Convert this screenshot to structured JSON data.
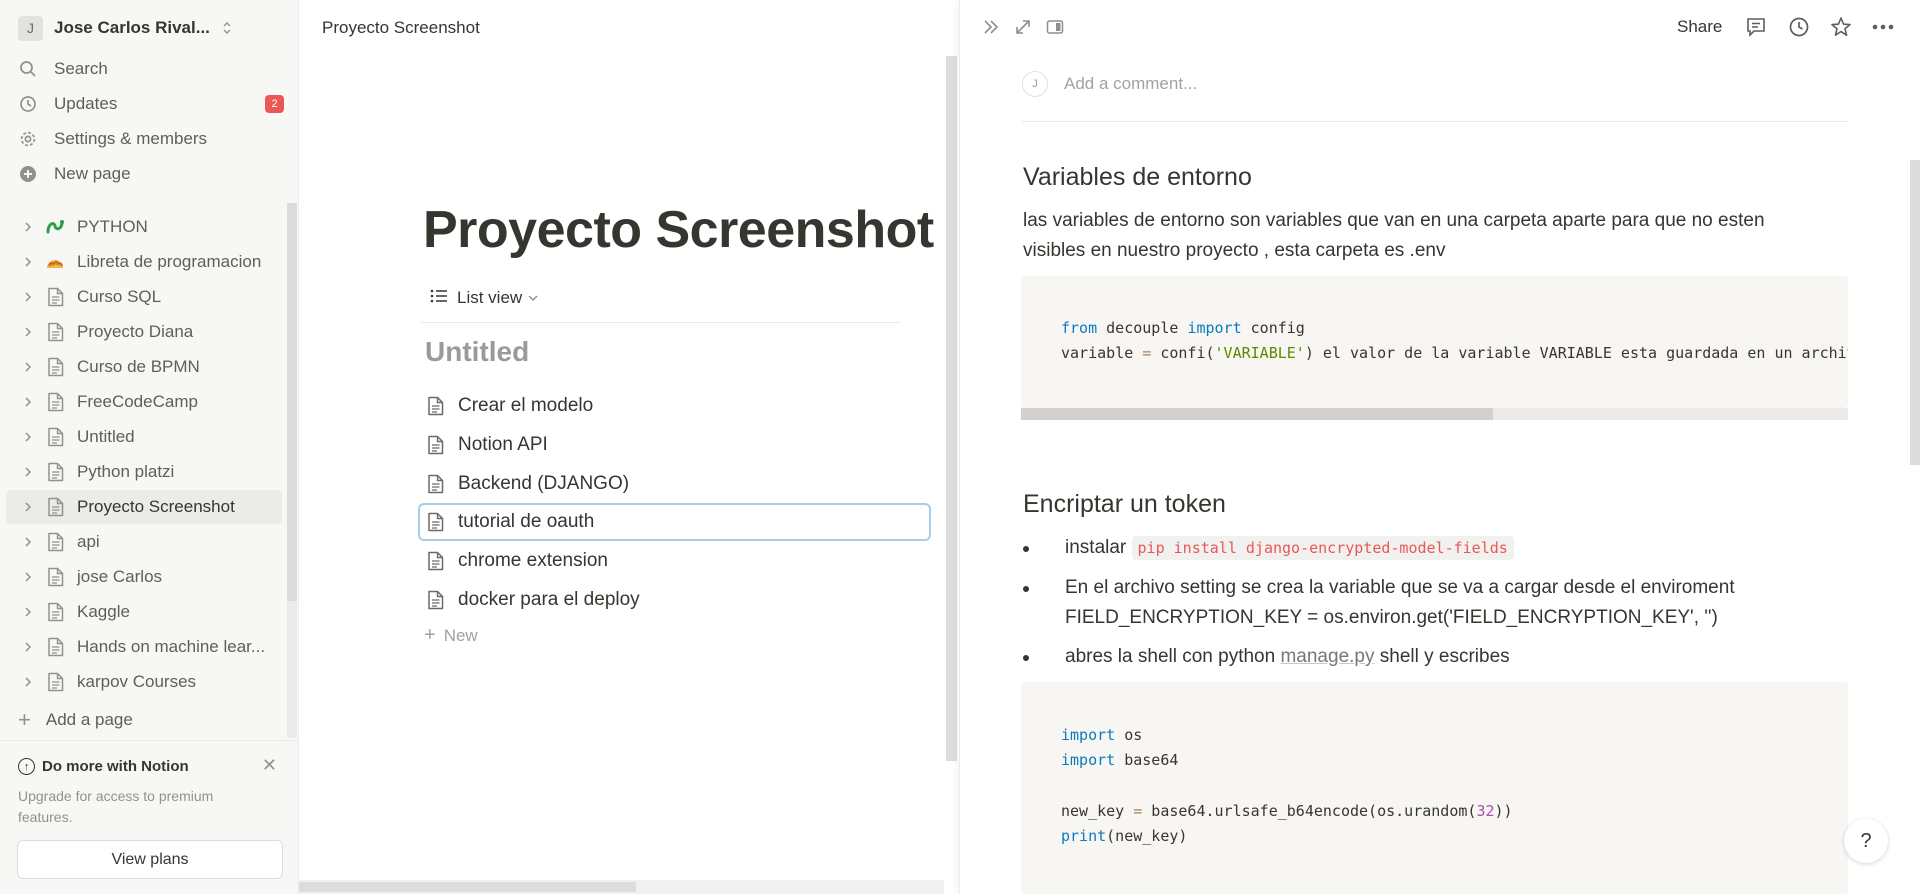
{
  "workspace": {
    "initial": "J",
    "name": "Jose Carlos Rival..."
  },
  "nav": {
    "search": "Search",
    "updates": "Updates",
    "updates_count": "2",
    "settings": "Settings & members",
    "new_page": "New page"
  },
  "pages": [
    {
      "label": "PYTHON",
      "icon": "python-icon"
    },
    {
      "label": "Libreta de programacion",
      "icon": "taco-emoji-icon"
    },
    {
      "label": "Curso SQL",
      "icon": "page-icon"
    },
    {
      "label": "Proyecto Diana",
      "icon": "page-icon"
    },
    {
      "label": "Curso de BPMN",
      "icon": "page-icon"
    },
    {
      "label": "FreeCodeCamp",
      "icon": "page-icon"
    },
    {
      "label": "Untitled",
      "icon": "page-icon"
    },
    {
      "label": "Python platzi",
      "icon": "page-icon"
    },
    {
      "label": "Proyecto Screenshot",
      "icon": "page-icon",
      "active": true
    },
    {
      "label": "api",
      "icon": "page-icon"
    },
    {
      "label": "jose Carlos",
      "icon": "page-icon"
    },
    {
      "label": "Kaggle",
      "icon": "page-icon"
    },
    {
      "label": "Hands on machine lear...",
      "icon": "page-icon"
    },
    {
      "label": "karpov Courses",
      "icon": "page-icon"
    }
  ],
  "add_page": "Add a page",
  "promo": {
    "title": "Do more with Notion",
    "text": "Upgrade for access to premium features.",
    "button": "View plans"
  },
  "middle": {
    "breadcrumb": "Proyecto Screenshot",
    "title": "Proyecto Screenshot",
    "view_label": "List view",
    "group_title": "Untitled",
    "items": [
      "Crear el modelo",
      "Notion API",
      "Backend (DJANGO)",
      "tutorial de oauth",
      "chrome extension",
      "docker para el deploy"
    ],
    "new_label": "New"
  },
  "right": {
    "share": "Share",
    "comment_avatar": "J",
    "comment_placeholder": "Add a comment...",
    "section1": {
      "heading": "Variables de entorno",
      "text": "las variables de entorno son variables que van en una carpeta aparte para que no esten visibles en nuestro proyecto , esta carpeta es .env",
      "code_kw1": "from",
      "code_mod": " decouple ",
      "code_kw2": "import",
      "code_rest1": " config",
      "code_l2a": "variable ",
      "code_l2op": "=",
      "code_l2b": " confi(",
      "code_l2str": "'VARIABLE'",
      "code_l2c": ") el valor de la variable VARIABLE esta guardada en un archivo"
    },
    "section2": {
      "heading": "Encriptar un token",
      "b1_text": "instalar ",
      "b1_code": "pip install django-encrypted-model-fields",
      "b2_text": "En el archivo setting se crea la variable que se va a cargar desde el enviroment FIELD_ENCRYPTION_KEY = os.environ.get('FIELD_ENCRYPTION_KEY', '')",
      "b3_pre": "abres la shell con python ",
      "b3_link": "manage.py",
      "b3_post": " shell y escribes",
      "code": {
        "l1kw": "import",
        "l1": " os",
        "l2kw": "import",
        "l2": " base64",
        "l4a": "new_key ",
        "l4op": "=",
        "l4b": " base64",
        "l4c": ".urlsafe_b64encode(os",
        "l4d": ".urandom(",
        "l4num": "32",
        "l4e": "))",
        "l5kw": "print",
        "l5": "(new_key)"
      }
    },
    "help": "?"
  }
}
